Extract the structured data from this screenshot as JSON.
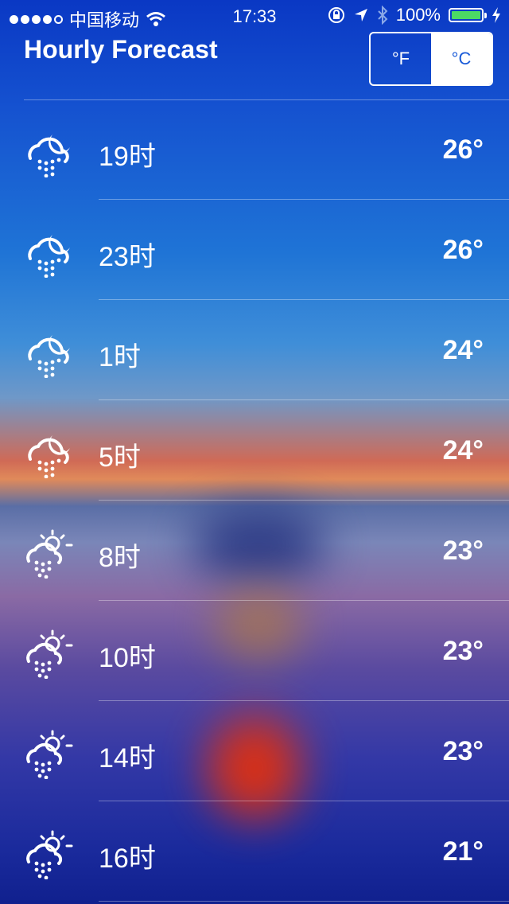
{
  "status_bar": {
    "carrier": "中国移动",
    "time": "17:33",
    "battery_percent": "100%",
    "battery_level": 1.0
  },
  "header": {
    "title": "Hourly Forecast",
    "unit_f": "°F",
    "unit_c": "°C",
    "selected_unit": "°C"
  },
  "colors": {
    "accent": "#1a5bd8",
    "battery": "#4cd964"
  },
  "forecast": [
    {
      "time": "19时",
      "temp": "26°",
      "icon": "cloud-moon-rain-icon"
    },
    {
      "time": "23时",
      "temp": "26°",
      "icon": "cloud-moon-rain-icon"
    },
    {
      "time": "1时",
      "temp": "24°",
      "icon": "cloud-moon-rain-icon"
    },
    {
      "time": "5时",
      "temp": "24°",
      "icon": "cloud-moon-rain-icon"
    },
    {
      "time": "8时",
      "temp": "23°",
      "icon": "cloud-sun-rain-icon"
    },
    {
      "time": "10时",
      "temp": "23°",
      "icon": "cloud-sun-rain-icon"
    },
    {
      "time": "14时",
      "temp": "23°",
      "icon": "cloud-sun-rain-icon"
    },
    {
      "time": "16时",
      "temp": "21°",
      "icon": "cloud-sun-rain-icon"
    }
  ]
}
